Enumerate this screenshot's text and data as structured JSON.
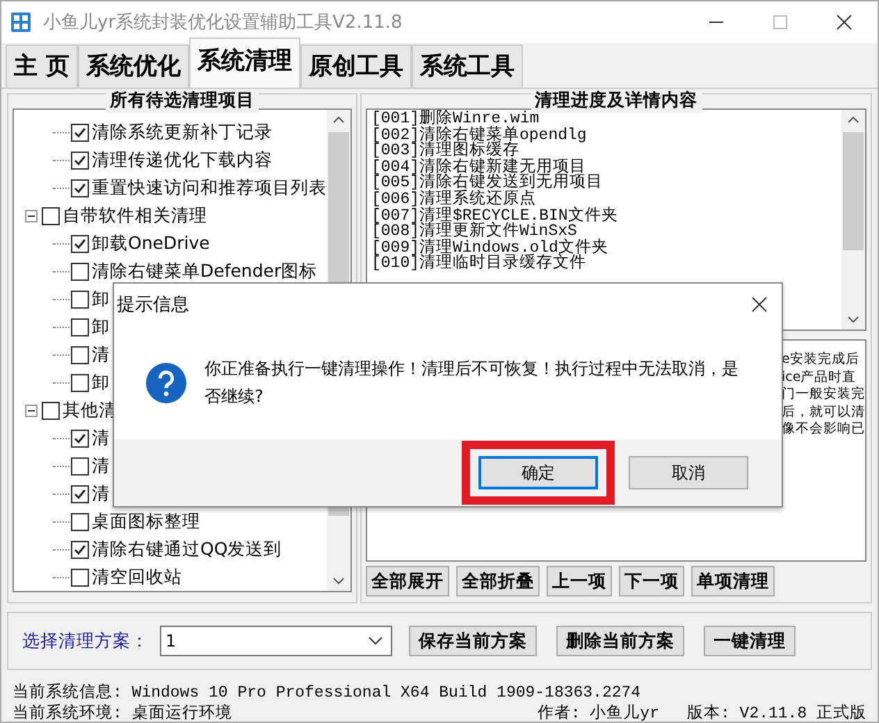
{
  "window": {
    "title": "小鱼儿yr系统封装优化设置辅助工具V2.11.8"
  },
  "tabs": [
    {
      "label": "主 页",
      "selected": false
    },
    {
      "label": "系统优化",
      "selected": false
    },
    {
      "label": "系统清理",
      "selected": true
    },
    {
      "label": "原创工具",
      "selected": false
    },
    {
      "label": "系统工具",
      "selected": false
    }
  ],
  "left_panel": {
    "title": "所有待选清理项目",
    "tree": [
      {
        "label": "清除系统更新补丁记录",
        "checked": true
      },
      {
        "label": "清理传递优化下载内容",
        "checked": true
      },
      {
        "label": "重置快速访问和推荐项目列表",
        "checked": true
      },
      {
        "label": "自带软件相关清理",
        "checked": false,
        "expanded": true,
        "children": [
          {
            "label": "卸载OneDrive",
            "checked": true
          },
          {
            "label": "清除右键菜单Defender图标",
            "checked": false
          },
          {
            "label": "卸",
            "checked": false
          },
          {
            "label": "卸",
            "checked": false
          },
          {
            "label": "清",
            "checked": false
          },
          {
            "label": "卸",
            "checked": false
          }
        ]
      },
      {
        "label": "其他清",
        "checked": false,
        "expanded": true,
        "children": [
          {
            "label": "清",
            "checked": true
          },
          {
            "label": "清",
            "checked": false
          },
          {
            "label": "清",
            "checked": true
          },
          {
            "label": "桌面图标整理",
            "checked": false
          },
          {
            "label": "清除右键通过QQ发送到",
            "checked": true
          },
          {
            "label": "清空回收站",
            "checked": false
          }
        ]
      }
    ]
  },
  "right_panel": {
    "title": "清理进度及详情内容",
    "log": [
      "[001]删除Winre.wim",
      "[002]清除右键菜单opendlg",
      "[003]清理图标缓存",
      "[004]清除右键新建无用项目",
      "[005]清除右键发送到无用项目",
      "[006]清理系统还原点",
      "[007]清理$RECYCLE.BIN文件夹",
      "[008]清理更新文件WinSxS",
      "[009]清理Windows.old文件夹",
      "[010]清理临时目录缓存文件"
    ],
    "details": [
      "e安装完成后",
      "ice产品时直",
      "门一般安装完",
      "后，就可以清",
      "像不会影响已"
    ],
    "buttons": [
      "全部展开",
      "全部折叠",
      "上一项",
      "下一项",
      "单项清理"
    ]
  },
  "scheme": {
    "label": "选择清理方案：",
    "value": "1",
    "buttons": [
      "保存当前方案",
      "删除当前方案",
      "一键清理"
    ]
  },
  "status": {
    "system_info": "当前系统信息: Windows 10 Pro Professional X64 Build 1909-18363.2274",
    "environment": "当前系统环境: 桌面运行环境",
    "author": "作者: 小鱼儿yr",
    "version": "版本: V2.11.8 正式版"
  },
  "dialog": {
    "title": "提示信息",
    "message": "你正准备执行一键清理操作！清理后不可恢复！执行过程中无法取消，是否继续?",
    "buttons": [
      {
        "label": "确定",
        "selected": true
      },
      {
        "label": "取消",
        "selected": false
      }
    ]
  }
}
